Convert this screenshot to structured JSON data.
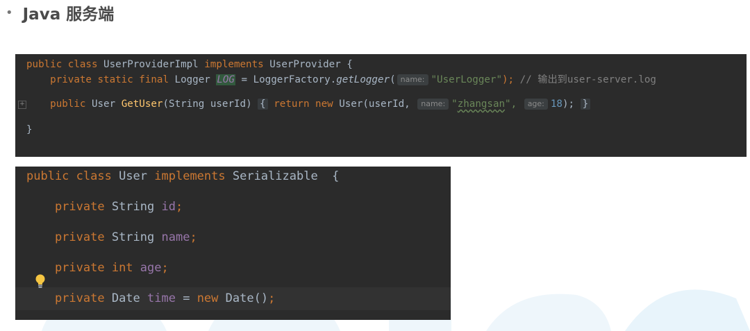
{
  "slide": {
    "bullet": "•",
    "title": "Java 服务端"
  },
  "impl_code": {
    "l1_public": "public ",
    "l1_class": "class ",
    "l1_name": "UserProviderImpl ",
    "l1_implements": "implements ",
    "l1_iface": "UserProvider {",
    "l2_modifiers": "    private static final ",
    "l2_type": "Logger ",
    "l2_field": "LOG",
    "l2_eq": " = LoggerFactory.",
    "l2_method": "getLogger",
    "l2_paren": "(",
    "l2_hint": "name:",
    "l2_arg": "\"UserLogger\"",
    "l2_close": ");",
    "l2_comment": " // 输出到user-server.log",
    "l3_public": "    public ",
    "l3_type": "User ",
    "l3_method": "GetUser",
    "l3_params": "(String userId) ",
    "l3_brace_open": "{",
    "l3_return": " return new ",
    "l3_ctor": "User(userId, ",
    "l3_hint_name": "name:",
    "l3_q_open": "\"",
    "l3_arg_name": "zhangsan",
    "l3_q_close": "\",",
    "l3_hint_age": "age:",
    "l3_arg_age": "18",
    "l3_close": "); ",
    "l3_brace_close": "}",
    "l4_brace": "}"
  },
  "user_code": {
    "l1_public": "public ",
    "l1_class": "class ",
    "l1_name": "User ",
    "l1_implements": "implements ",
    "l1_iface": "Serializable  {",
    "l2_private": "    private ",
    "l2_type": "String ",
    "l2_field": "id",
    "l2_semi": ";",
    "l3_private": "    private ",
    "l3_type": "String ",
    "l3_field": "name",
    "l3_semi": ";",
    "l4_private": "    private ",
    "l4_type": "int ",
    "l4_field": "age",
    "l4_semi": ";",
    "l5_private": "    private ",
    "l5_type": "Date ",
    "l5_field": "time",
    "l5_eq": " = ",
    "l5_new": "new ",
    "l5_ctor": "Date()",
    "l5_semi": ";"
  },
  "icons": {
    "gutter": "fold-collapse-icon",
    "bulb": "lightbulb-intention-icon"
  },
  "colors": {
    "editor_bg": "#2b2b2b",
    "keyword": "#cc7832",
    "string": "#6a8759",
    "number": "#6897bb",
    "field": "#9876aa",
    "comment": "#808080",
    "method": "#ffc66d",
    "text": "#a9b7c6"
  }
}
